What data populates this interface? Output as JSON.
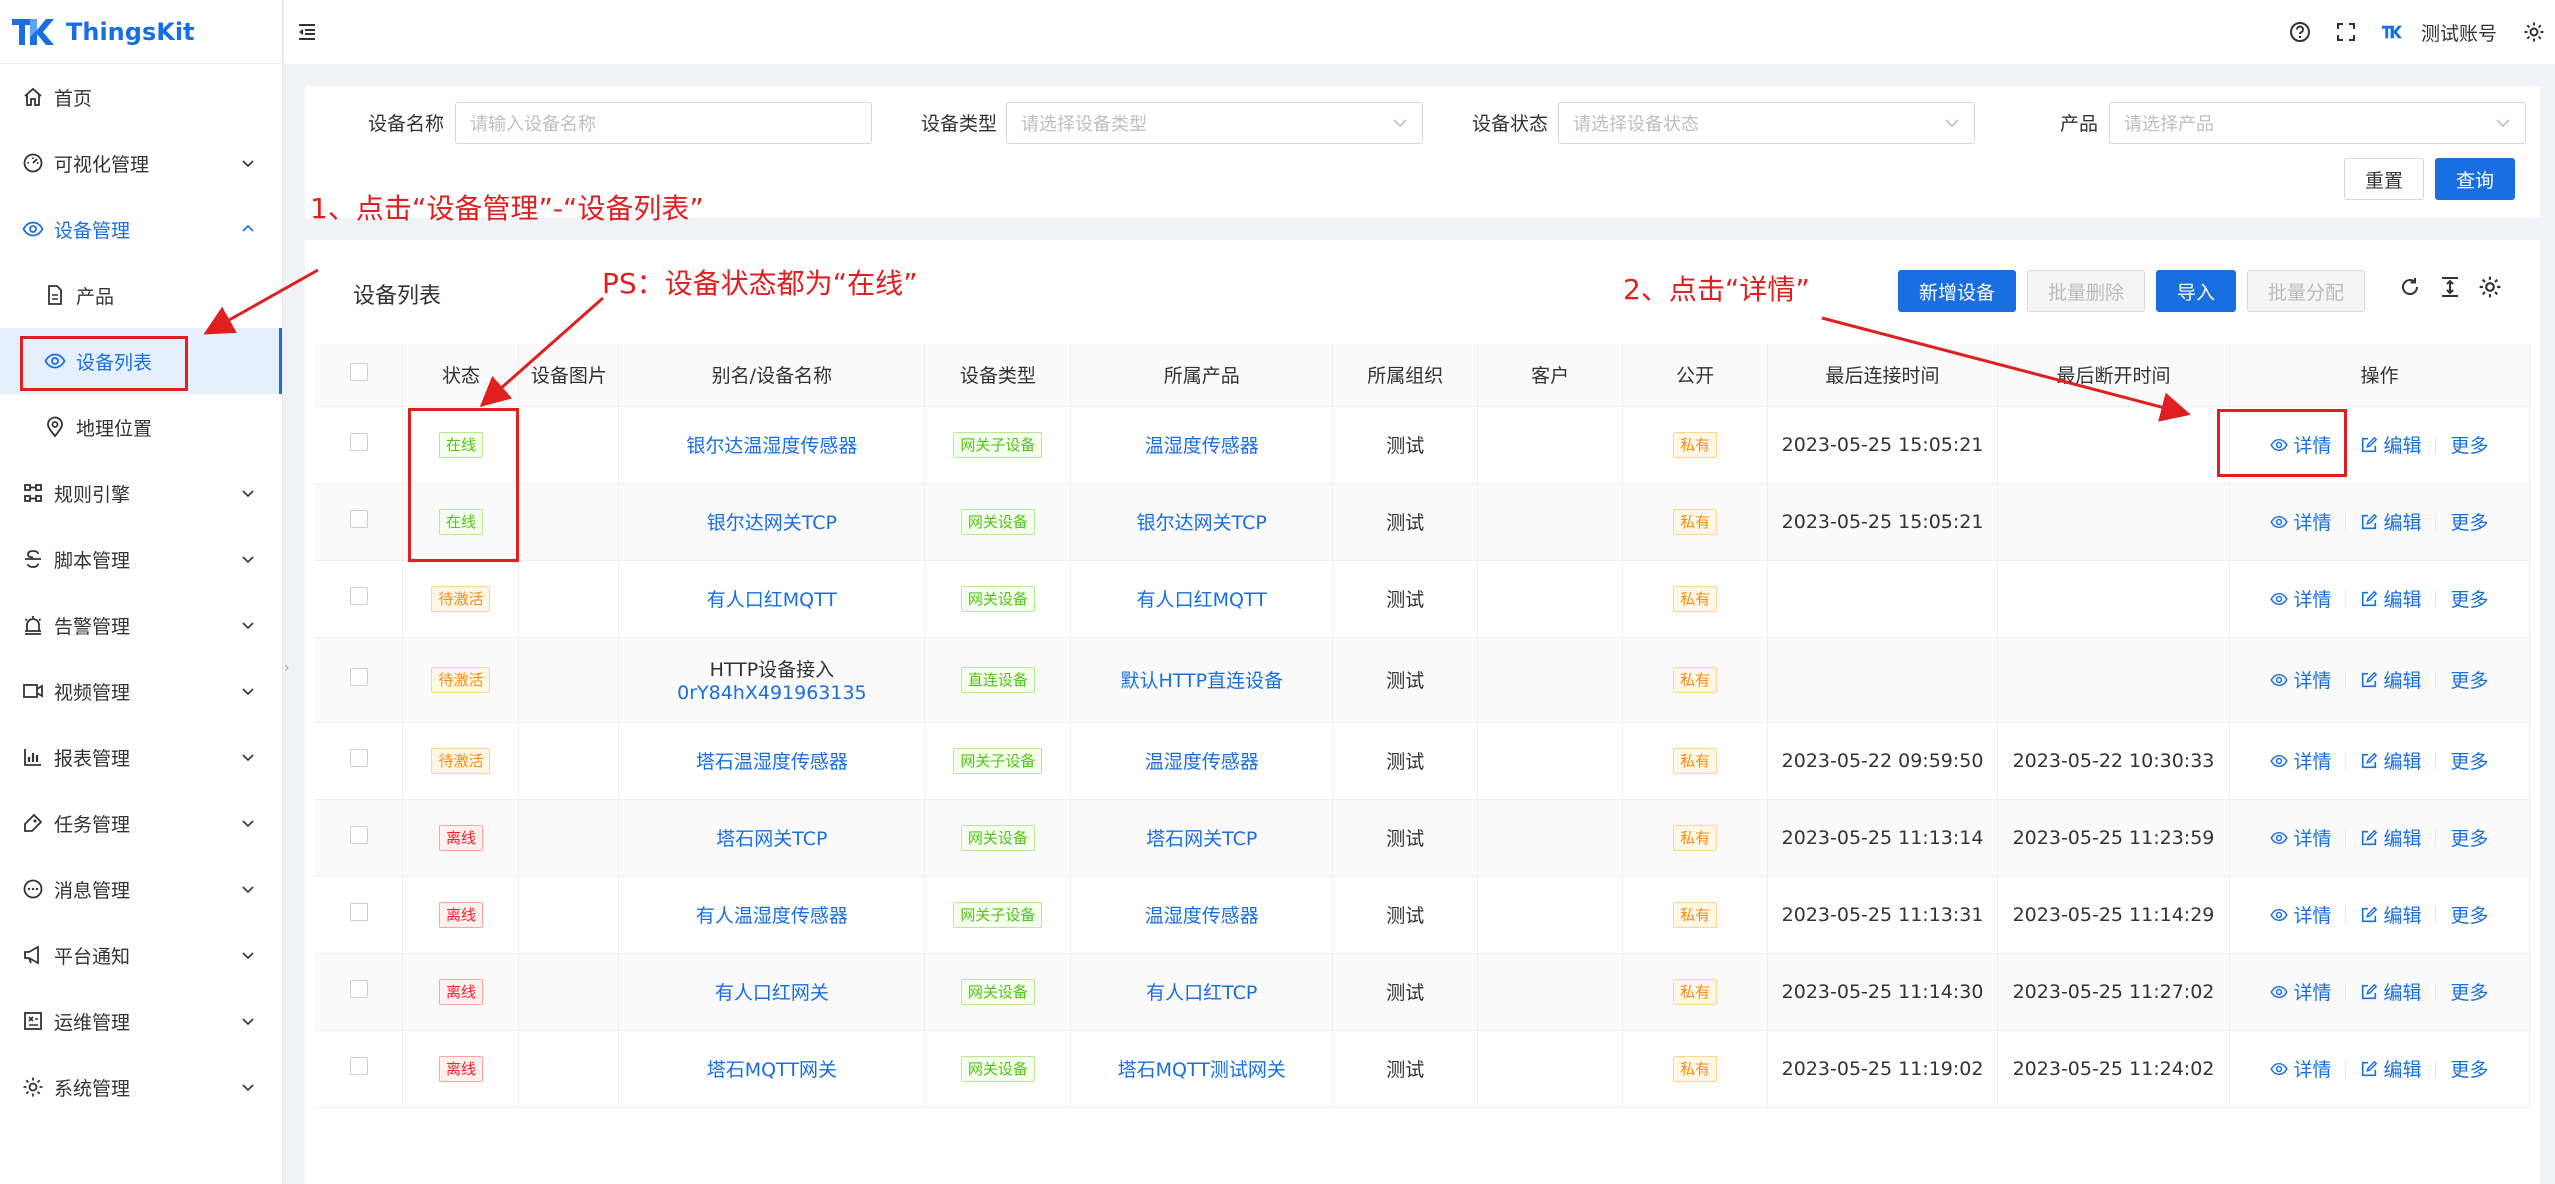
{
  "app": {
    "name": "ThingsKit",
    "account": "测试账号"
  },
  "sidebar": {
    "items": [
      {
        "label": "首页",
        "icon": "home-icon"
      },
      {
        "label": "可视化管理",
        "icon": "dashboard-icon"
      },
      {
        "label": "设备管理",
        "icon": "eye-icon"
      },
      {
        "label": "产品",
        "icon": "file-icon"
      },
      {
        "label": "设备列表",
        "icon": "eye-icon"
      },
      {
        "label": "地理位置",
        "icon": "location-icon"
      },
      {
        "label": "规则引擎",
        "icon": "rule-icon"
      },
      {
        "label": "脚本管理",
        "icon": "script-icon"
      },
      {
        "label": "告警管理",
        "icon": "alarm-icon"
      },
      {
        "label": "视频管理",
        "icon": "video-icon"
      },
      {
        "label": "报表管理",
        "icon": "chart-icon"
      },
      {
        "label": "任务管理",
        "icon": "task-icon"
      },
      {
        "label": "消息管理",
        "icon": "message-icon"
      },
      {
        "label": "平台通知",
        "icon": "notice-icon"
      },
      {
        "label": "运维管理",
        "icon": "ops-icon"
      },
      {
        "label": "系统管理",
        "icon": "gear-icon"
      }
    ]
  },
  "search": {
    "device_name_label": "设备名称",
    "device_name_placeholder": "请输入设备名称",
    "device_type_label": "设备类型",
    "device_type_placeholder": "请选择设备类型",
    "device_status_label": "设备状态",
    "device_status_placeholder": "请选择设备状态",
    "product_label": "产品",
    "product_placeholder": "请选择产品",
    "reset_label": "重置",
    "query_label": "查询"
  },
  "panel": {
    "title": "设备列表",
    "add_label": "新增设备",
    "batch_delete_label": "批量删除",
    "import_label": "导入",
    "batch_assign_label": "批量分配"
  },
  "table": {
    "headers": [
      "状态",
      "设备图片",
      "别名/设备名称",
      "设备类型",
      "所属产品",
      "所属组织",
      "客户",
      "公开",
      "最后连接时间",
      "最后断开时间",
      "操作"
    ],
    "op_detail": "详情",
    "op_edit": "编辑",
    "op_more": "更多",
    "rows": [
      {
        "status": "在线",
        "status_color": "green",
        "name": "银尔达温湿度传感器",
        "name2": "",
        "type": "网关子设备",
        "product": "温湿度传感器",
        "org": "测试",
        "public": "私有",
        "last_conn": "2023-05-25 15:05:21",
        "last_disc": ""
      },
      {
        "status": "在线",
        "status_color": "green",
        "name": "银尔达网关TCP",
        "name2": "",
        "type": "网关设备",
        "product": "银尔达网关TCP",
        "org": "测试",
        "public": "私有",
        "last_conn": "2023-05-25 15:05:21",
        "last_disc": ""
      },
      {
        "status": "待激活",
        "status_color": "orange",
        "name": "有人口红MQTT",
        "name2": "",
        "type": "网关设备",
        "product": "有人口红MQTT",
        "org": "测试",
        "public": "私有",
        "last_conn": "",
        "last_disc": ""
      },
      {
        "status": "待激活",
        "status_color": "orange",
        "name": "HTTP设备接入",
        "name2": "0rY84hX491963135",
        "type": "直连设备",
        "product": "默认HTTP直连设备",
        "org": "测试",
        "public": "私有",
        "last_conn": "",
        "last_disc": ""
      },
      {
        "status": "待激活",
        "status_color": "orange",
        "name": "塔石温湿度传感器",
        "name2": "",
        "type": "网关子设备",
        "product": "温湿度传感器",
        "org": "测试",
        "public": "私有",
        "last_conn": "2023-05-22 09:59:50",
        "last_disc": "2023-05-22 10:30:33"
      },
      {
        "status": "离线",
        "status_color": "red",
        "name": "塔石网关TCP",
        "name2": "",
        "type": "网关设备",
        "product": "塔石网关TCP",
        "org": "测试",
        "public": "私有",
        "last_conn": "2023-05-25 11:13:14",
        "last_disc": "2023-05-25 11:23:59"
      },
      {
        "status": "离线",
        "status_color": "red",
        "name": "有人温湿度传感器",
        "name2": "",
        "type": "网关子设备",
        "product": "温湿度传感器",
        "org": "测试",
        "public": "私有",
        "last_conn": "2023-05-25 11:13:31",
        "last_disc": "2023-05-25 11:14:29"
      },
      {
        "status": "离线",
        "status_color": "red",
        "name": "有人口红网关",
        "name2": "",
        "type": "网关设备",
        "product": "有人口红TCP",
        "org": "测试",
        "public": "私有",
        "last_conn": "2023-05-25 11:14:30",
        "last_disc": "2023-05-25 11:27:02"
      },
      {
        "status": "离线",
        "status_color": "red",
        "name": "塔石MQTT网关",
        "name2": "",
        "type": "网关设备",
        "product": "塔石MQTT测试网关",
        "org": "测试",
        "public": "私有",
        "last_conn": "2023-05-25 11:19:02",
        "last_disc": "2023-05-25 11:24:02"
      }
    ]
  },
  "annotations": {
    "step1": "1、点击“设备管理”-“设备列表”",
    "ps": "PS：设备状态都为“在线”",
    "step2": "2、点击“详情”"
  }
}
